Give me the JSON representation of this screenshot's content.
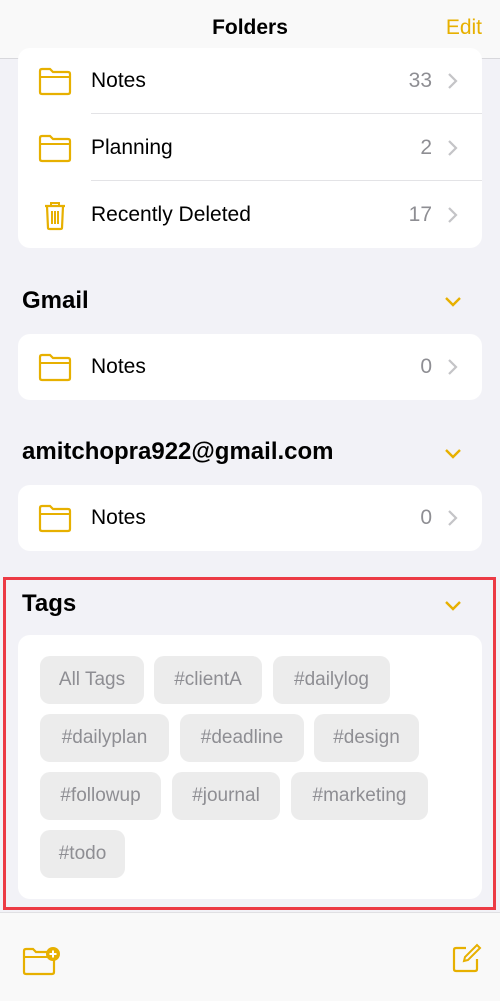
{
  "header": {
    "title": "Folders",
    "edit_label": "Edit"
  },
  "icloud_folders": [
    {
      "label": "Notes",
      "count": "33",
      "icon": "folder-icon"
    },
    {
      "label": "Planning",
      "count": "2",
      "icon": "folder-icon"
    },
    {
      "label": "Recently Deleted",
      "count": "17",
      "icon": "trash-icon"
    }
  ],
  "gmail": {
    "title": "Gmail",
    "folders": [
      {
        "label": "Notes",
        "count": "0",
        "icon": "folder-icon"
      }
    ]
  },
  "account": {
    "title": "amitchopra922@gmail.com",
    "folders": [
      {
        "label": "Notes",
        "count": "0",
        "icon": "folder-icon"
      }
    ]
  },
  "tags": {
    "title": "Tags",
    "items": [
      "All Tags",
      "#clientA",
      "#dailylog",
      "#dailyplan",
      "#deadline",
      "#design",
      "#followup",
      "#journal",
      "#marketing",
      "#todo"
    ]
  },
  "colors": {
    "accent": "#e7b000",
    "highlight_border": "#ec3b45",
    "background": "#f2f2f7"
  },
  "toolbar": {
    "new_folder_icon": "new-folder-icon",
    "compose_icon": "compose-icon"
  }
}
